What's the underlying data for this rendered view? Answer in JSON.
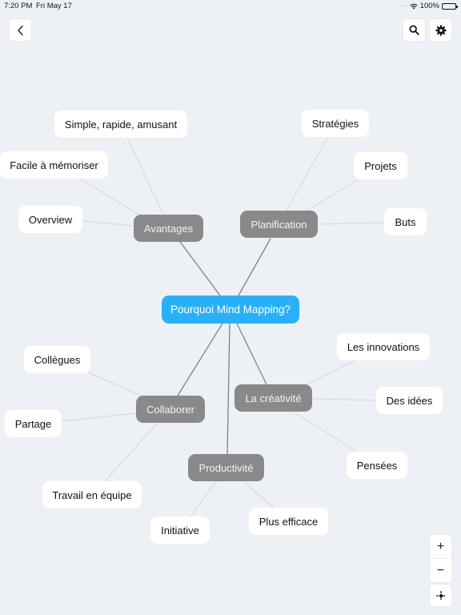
{
  "status_bar": {
    "time": "7:20 PM",
    "date": "Fri May 17",
    "battery": "100%"
  },
  "toolbar": {
    "back_icon": "chevron-left-icon",
    "search_icon": "search-icon",
    "settings_icon": "gear-icon"
  },
  "colors": {
    "background": "#edf1f6",
    "root": "#2ab0f8",
    "branch": "#87898b",
    "leaf": "#ffffff",
    "main_edge": "#7f8285",
    "leaf_edge": "#d3d7dc"
  },
  "mindmap": {
    "root": "Pourquoi Mind Mapping?",
    "branches": [
      {
        "label": "Avantages",
        "children": [
          "Simple, rapide, amusant",
          "Facile à mémoriser",
          "Overview"
        ]
      },
      {
        "label": "Planification",
        "children": [
          "Stratégies",
          "Projets",
          "Buts"
        ]
      },
      {
        "label": "Collaborer",
        "children": [
          "Collègues",
          "Partage",
          "Travail en équipe"
        ]
      },
      {
        "label": "Productivité",
        "children": [
          "Initiative",
          "Plus efficace"
        ]
      },
      {
        "label": "La créativité",
        "children": [
          "Les innovations",
          "Des idées",
          "Pensées"
        ]
      }
    ]
  },
  "zoom_controls": {
    "zoom_in": "+",
    "zoom_out": "−",
    "recenter_icon": "crosshair-icon"
  }
}
